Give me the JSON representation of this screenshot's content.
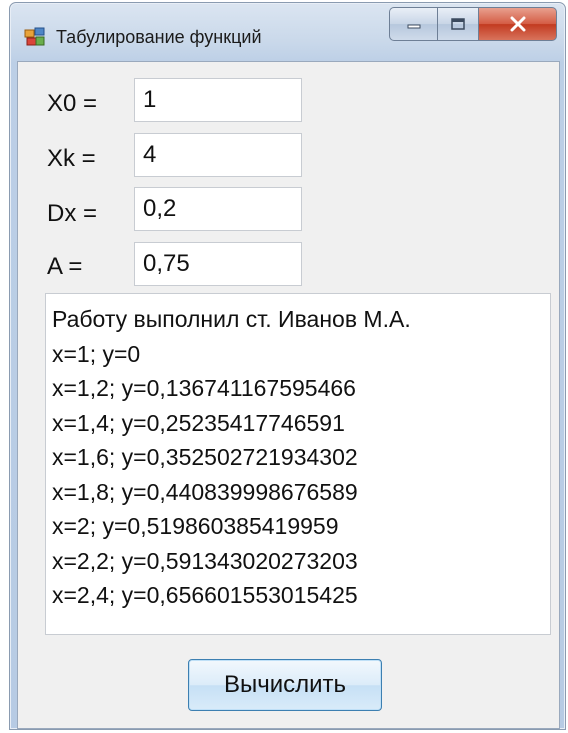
{
  "window": {
    "title": "Табулирование функций",
    "controls": {
      "minimize": "minimize-icon",
      "maximize": "maximize-icon",
      "close": "close-icon"
    }
  },
  "form": {
    "x0": {
      "label": "X0 =",
      "value": "1"
    },
    "xk": {
      "label": "Xk =",
      "value": "4"
    },
    "dx": {
      "label": "Dx =",
      "value": "0,2"
    },
    "a": {
      "label": "A =",
      "value": "0,75"
    }
  },
  "output": {
    "lines": [
      "Работу выполнил ст. Иванов М.А.",
      "x=1; y=0",
      "x=1,2; y=0,136741167595466",
      "x=1,4; y=0,25235417746591",
      "x=1,6; y=0,352502721934302",
      "x=1,8; y=0,440839998676589",
      "x=2; y=0,519860385419959",
      "x=2,2; y=0,591343020273203",
      "x=2,4; y=0,656601553015425"
    ]
  },
  "buttons": {
    "compute": "Вычислить"
  },
  "colors": {
    "close_button": "#d45c44",
    "button_border": "#3c7fb1",
    "frame": "#bccfe6"
  }
}
